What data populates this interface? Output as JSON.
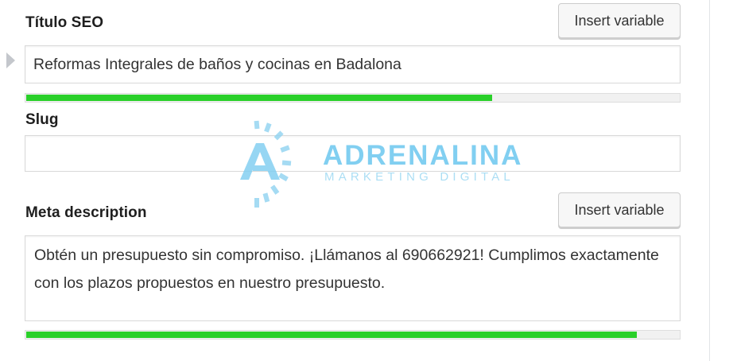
{
  "seo_title": {
    "label": "Título SEO",
    "insert_button": "Insert variable",
    "value": "Reformas Integrales de baños y cocinas en Badalona",
    "progress": 0.715
  },
  "slug": {
    "label": "Slug",
    "value": ""
  },
  "meta_description": {
    "label": "Meta description",
    "insert_button": "Insert variable",
    "value": "Obtén un presupuesto sin compromiso. ¡Llámanos al 690662921! Cumplimos exactamente con los plazos propuestos en nuestro presupuesto.",
    "progress": 0.935
  },
  "watermark": {
    "name": "ADRENALINA",
    "tagline": "MARKETING DIGITAL"
  },
  "colors": {
    "progress_good": "#2ad02a",
    "watermark": "#6cc7ef"
  }
}
